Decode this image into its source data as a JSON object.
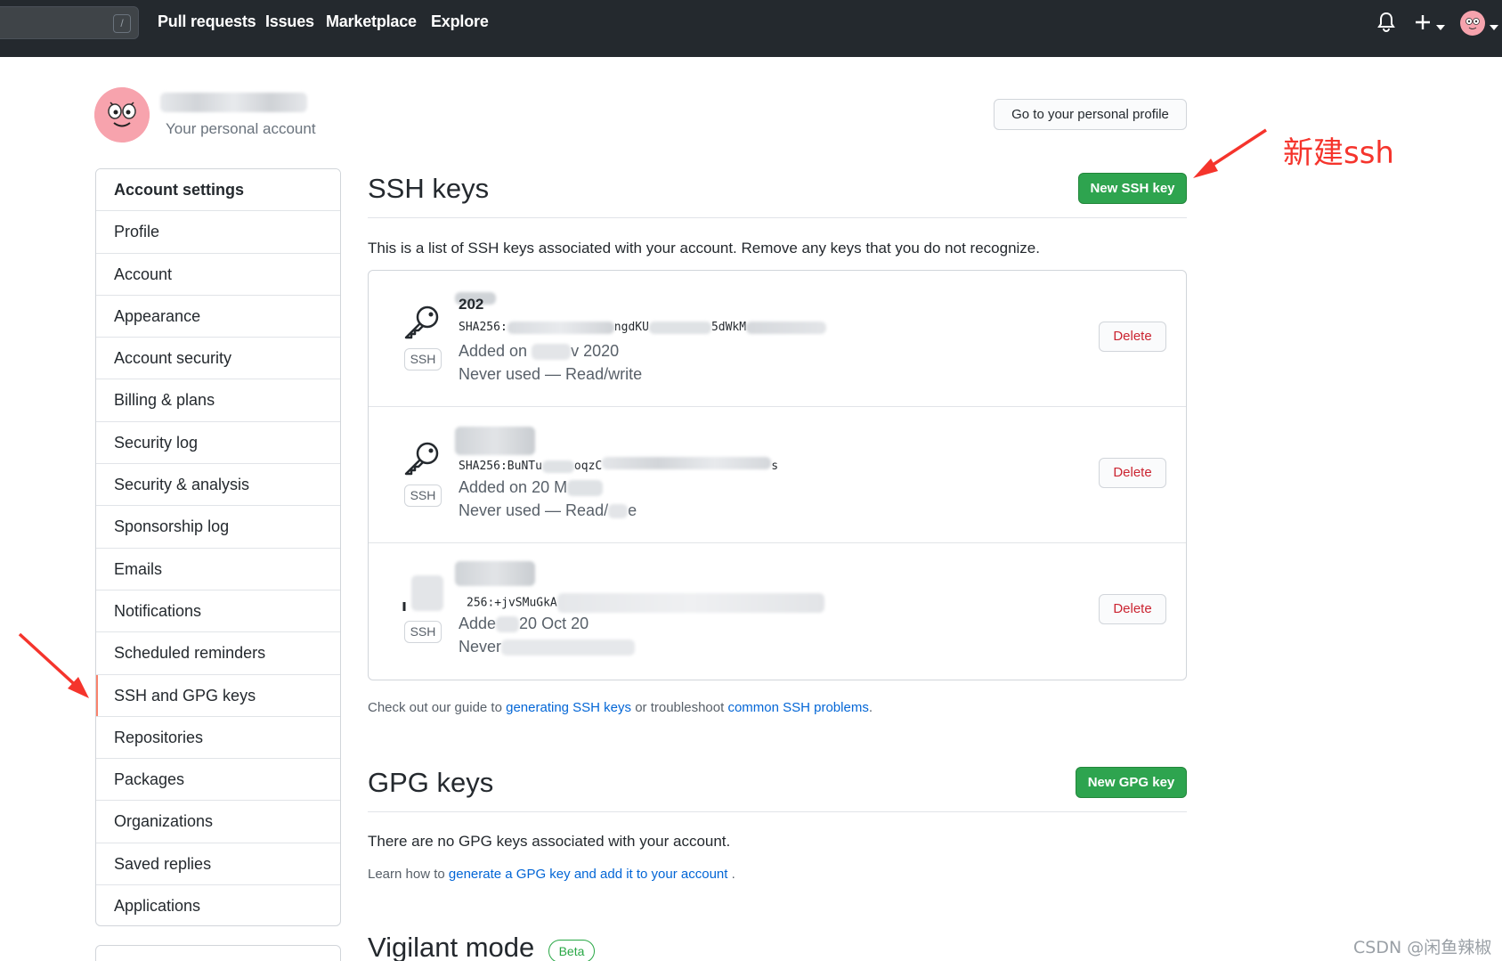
{
  "header": {
    "search_shortcut": "/",
    "nav": [
      "Pull requests",
      "Issues",
      "Marketplace",
      "Explore"
    ],
    "icons": [
      "bell-icon",
      "plus-icon",
      "caret-down-icon",
      "avatar"
    ]
  },
  "account": {
    "subtitle": "Your personal account",
    "profile_button": "Go to your personal profile"
  },
  "sidebar": {
    "items": [
      {
        "label": "Account settings",
        "heading": true
      },
      {
        "label": "Profile"
      },
      {
        "label": "Account"
      },
      {
        "label": "Appearance"
      },
      {
        "label": "Account security"
      },
      {
        "label": "Billing & plans"
      },
      {
        "label": "Security log"
      },
      {
        "label": "Security & analysis"
      },
      {
        "label": "Sponsorship log"
      },
      {
        "label": "Emails"
      },
      {
        "label": "Notifications"
      },
      {
        "label": "Scheduled reminders"
      },
      {
        "label": "SSH and GPG keys",
        "selected": true
      },
      {
        "label": "Repositories"
      },
      {
        "label": "Packages"
      },
      {
        "label": "Organizations"
      },
      {
        "label": "Saved replies"
      },
      {
        "label": "Applications"
      }
    ]
  },
  "ssh": {
    "title": "SSH keys",
    "new_button": "New SSH key",
    "description": "This is a list of SSH keys associated with your account. Remove any keys that you do not recognize.",
    "badge": "SSH",
    "delete_label": "Delete",
    "keys": [
      {
        "title": "202",
        "fingerprint_a": "SHA256:",
        "fingerprint_b": "ngdKU",
        "fingerprint_c": "5dWkM",
        "added": "Added on",
        "added_tail": "v 2020",
        "usage": "Never used — Read/write"
      },
      {
        "title": "",
        "fingerprint_a": "SHA256:BuNTu",
        "fingerprint_b": "oqzC",
        "fingerprint_c": "s",
        "added": "Added on 20 M",
        "added_tail": "",
        "usage": "Never used — Read/",
        "usage_tail": "e"
      },
      {
        "title": "",
        "fingerprint_a": "256:+jvSMuGkA",
        "fingerprint_b": "",
        "fingerprint_c": "",
        "added": "Adde",
        "added_tail": "20 Oct 20",
        "usage": "Never"
      }
    ],
    "guide_prefix": "Check out our guide to ",
    "guide_link1": "generating SSH keys",
    "guide_middle": " or troubleshoot ",
    "guide_link2": "common SSH problems",
    "guide_suffix": "."
  },
  "gpg": {
    "title": "GPG keys",
    "new_button": "New GPG key",
    "empty": "There are no GPG keys associated with your account.",
    "learn_prefix": "Learn how to ",
    "learn_link": "generate a GPG key and add it to your account",
    "learn_suffix": " ."
  },
  "vigilant": {
    "title": "Vigilant mode",
    "badge": "Beta"
  },
  "annotation": {
    "label": "新建ssh",
    "color": "#f5342c"
  },
  "watermark": "CSDN @闲鱼辣椒",
  "colors": {
    "header_bg": "#24292e",
    "green": "#2ea44f",
    "danger": "#cb2431",
    "link": "#0366d6",
    "selected_marker": "#f9826c"
  }
}
